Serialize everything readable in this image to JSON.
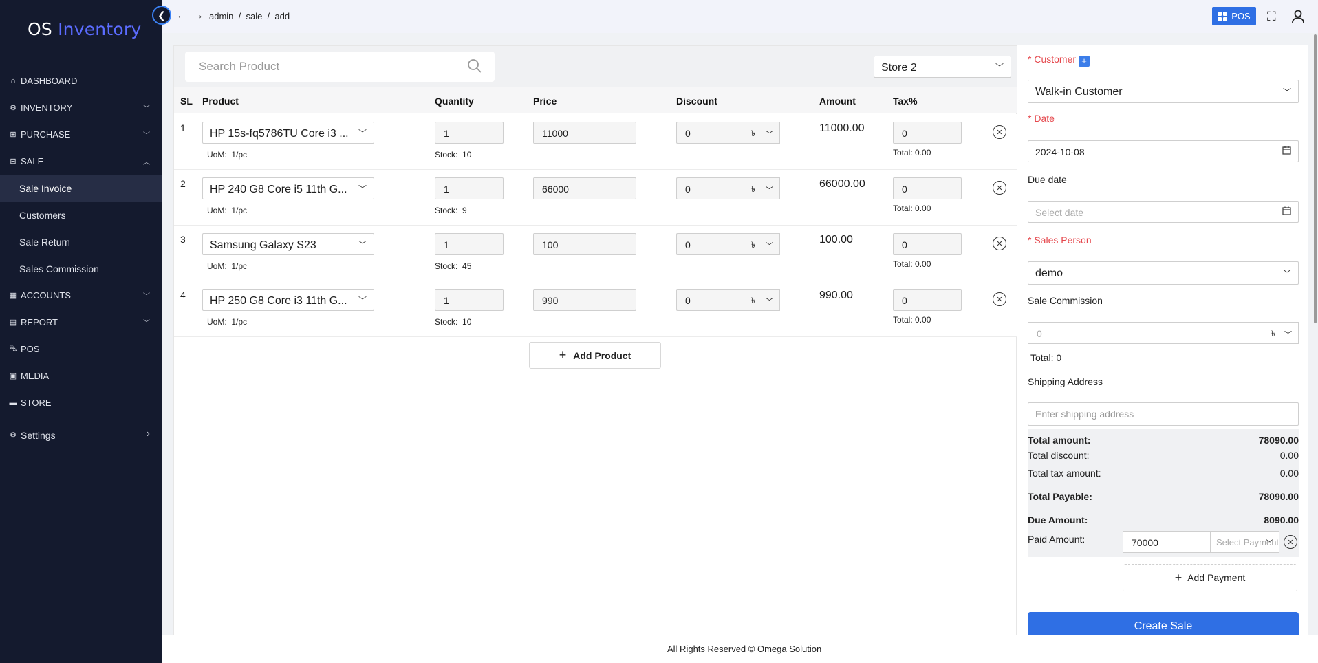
{
  "app": {
    "logo_os": "OS",
    "logo_inventory": "Inventory"
  },
  "topbar": {
    "breadcrumb": "admin  /  sale  /  add",
    "pos_label": "POS"
  },
  "sidebar": {
    "items": [
      {
        "icon": "home-icon",
        "label": "DASHBOARD",
        "chevron": ""
      },
      {
        "icon": "gear-icon",
        "label": "INVENTORY",
        "chevron": "﹀"
      },
      {
        "icon": "plus-square-icon",
        "label": "PURCHASE",
        "chevron": "﹀"
      },
      {
        "icon": "minus-square-icon",
        "label": "SALE",
        "chevron": "︿"
      },
      {
        "icon": "",
        "label": "Sale Invoice",
        "sub": true,
        "active": true
      },
      {
        "icon": "",
        "label": "Customers",
        "sub": true
      },
      {
        "icon": "",
        "label": "Sale Return",
        "sub": true
      },
      {
        "icon": "",
        "label": "Sales Commission",
        "sub": true
      },
      {
        "icon": "calculator-icon",
        "label": "ACCOUNTS",
        "chevron": "﹀"
      },
      {
        "icon": "report-icon",
        "label": "REPORT",
        "chevron": "﹀"
      },
      {
        "icon": "cart-icon",
        "label": "POS",
        "chevron": ""
      },
      {
        "icon": "image-icon",
        "label": "MEDIA",
        "chevron": ""
      },
      {
        "icon": "store-icon",
        "label": "STORE",
        "chevron": ""
      },
      {
        "icon": "settings-icon",
        "label": "Settings",
        "chevron": "›"
      }
    ]
  },
  "search": {
    "placeholder": "Search Product"
  },
  "store": {
    "selected": "Store 2"
  },
  "table": {
    "headers": {
      "sl": "SL",
      "product": "Product",
      "quantity": "Quantity",
      "price": "Price",
      "discount": "Discount",
      "amount": "Amount",
      "tax": "Tax%"
    },
    "uom_label": "UoM:",
    "stock_label": "Stock:",
    "total_label": "Total:",
    "discount_unit": "৳",
    "rows": [
      {
        "sl": "1",
        "product": "HP 15s-fq5786TU Core i3 ...",
        "uom": "1/pc",
        "quantity": "1",
        "stock": "10",
        "price": "11000",
        "discount": "0",
        "amount": "11000.00",
        "tax": "0",
        "tax_total": "0.00"
      },
      {
        "sl": "2",
        "product": "HP 240 G8 Core i5 11th G...",
        "uom": "1/pc",
        "quantity": "1",
        "stock": "9",
        "price": "66000",
        "discount": "0",
        "amount": "66000.00",
        "tax": "0",
        "tax_total": "0.00"
      },
      {
        "sl": "3",
        "product": "Samsung Galaxy S23",
        "uom": "1/pc",
        "quantity": "1",
        "stock": "45",
        "price": "100",
        "discount": "0",
        "amount": "100.00",
        "tax": "0",
        "tax_total": "0.00"
      },
      {
        "sl": "4",
        "product": "HP 250 G8 Core i3 11th G...",
        "uom": "1/pc",
        "quantity": "1",
        "stock": "10",
        "price": "990",
        "discount": "0",
        "amount": "990.00",
        "tax": "0",
        "tax_total": "0.00"
      }
    ],
    "add_product_label": "Add Product"
  },
  "form": {
    "customer_label": "* Customer",
    "customer_value": "Walk-in Customer",
    "date_label": "* Date",
    "date_value": "2024-10-08",
    "due_date_label": "Due date",
    "due_date_placeholder": "Select date",
    "sales_person_label": "* Sales Person",
    "sales_person_value": "demo",
    "commission_label": "Sale Commission",
    "commission_placeholder": "0",
    "commission_unit": "৳",
    "commission_total": "Total: 0",
    "shipping_label": "Shipping Address",
    "shipping_placeholder": "Enter shipping address"
  },
  "totals": {
    "total_amount_label": "Total amount:",
    "total_amount": "78090.00",
    "total_discount_label": "Total discount:",
    "total_discount": "0.00",
    "total_tax_label": "Total tax amount:",
    "total_tax": "0.00",
    "total_payable_label": "Total Payable:",
    "total_payable": "78090.00",
    "due_amount_label": "Due Amount:",
    "due_amount": "8090.00",
    "paid_amount_label": "Paid Amount:",
    "paid_amount": "70000",
    "payment_placeholder": "Select Payment",
    "add_payment_label": "Add Payment"
  },
  "create_sale_label": "Create Sale",
  "footer": "All Rights Reserved © Omega Solution"
}
